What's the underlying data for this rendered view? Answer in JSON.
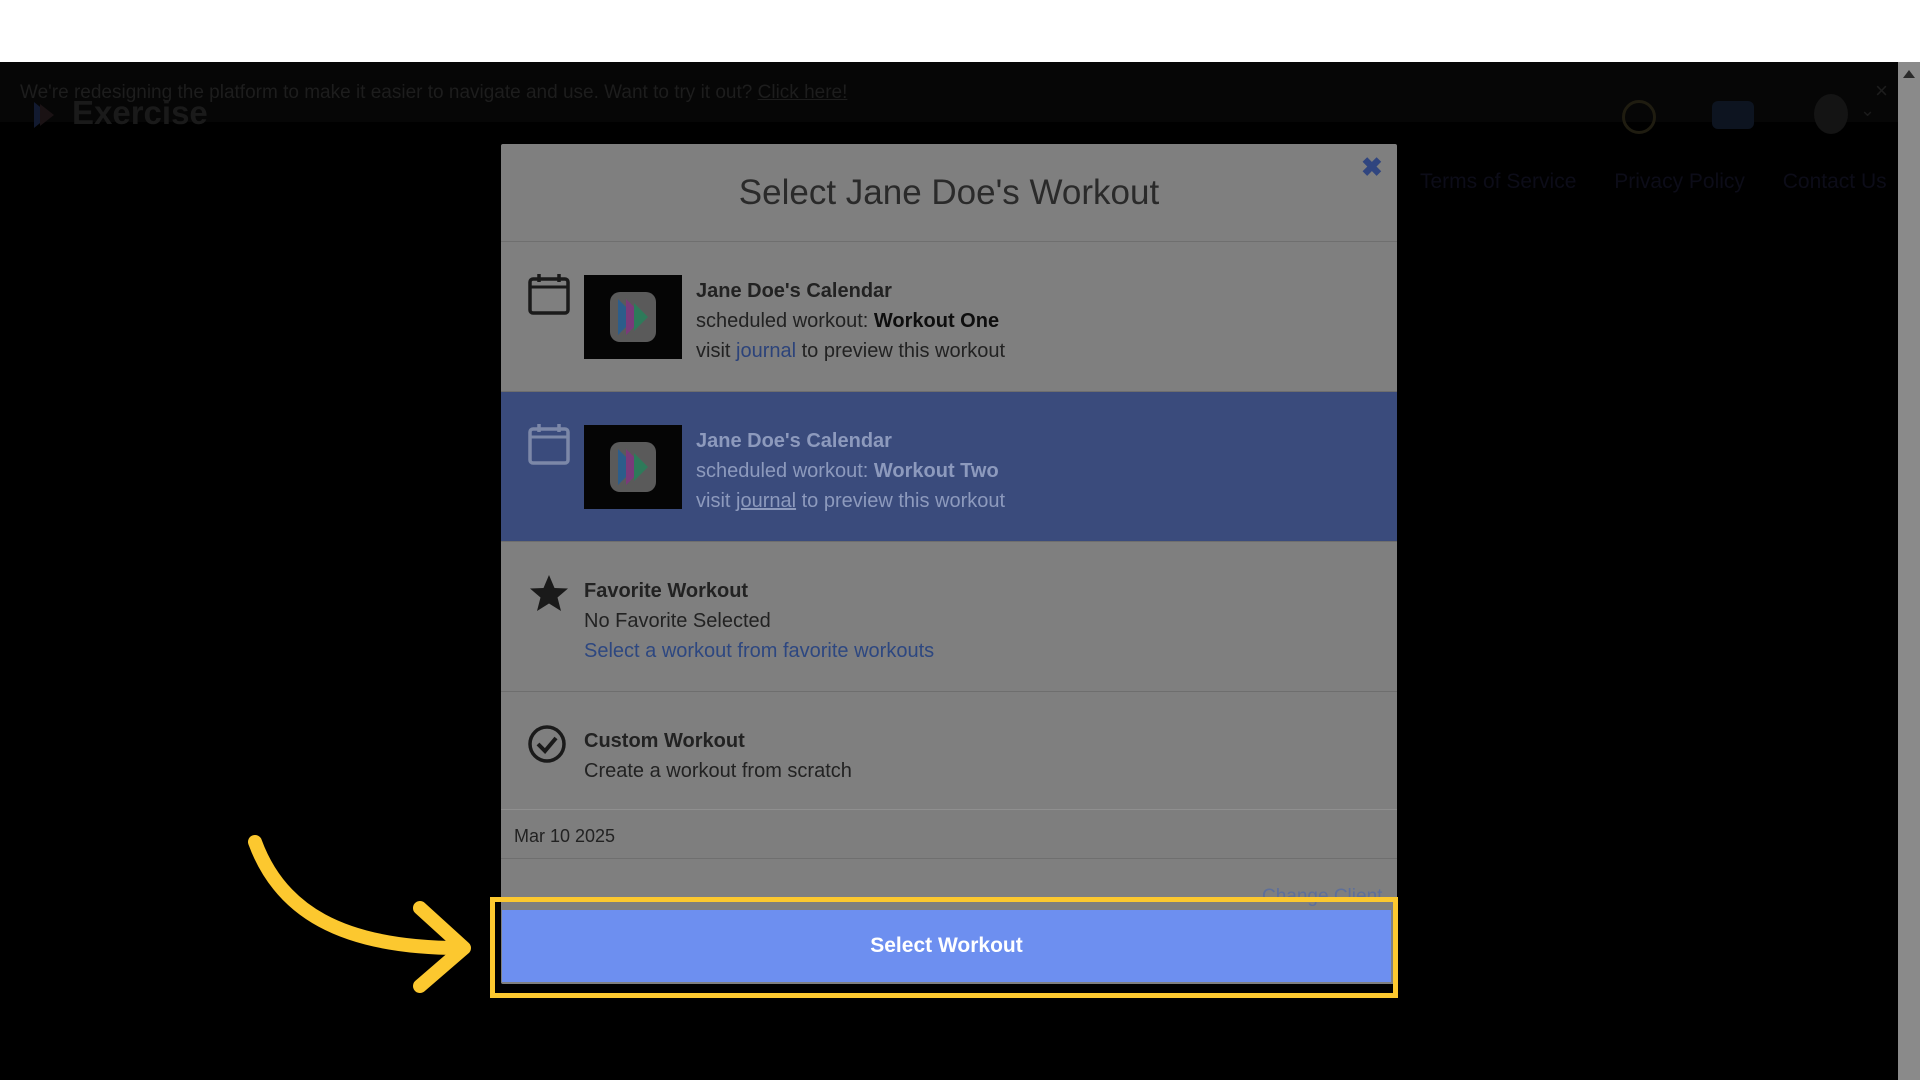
{
  "banner": {
    "message": "We're redesigning the platform to make it easier to navigate and use. Want to try it out?",
    "link_label": "Click here!",
    "close_glyph": "×"
  },
  "app": {
    "logo_text": "Exercise"
  },
  "footer_links": [
    "Terms of Service",
    "Privacy Policy",
    "Contact Us"
  ],
  "modal": {
    "title": "Select Jane Doe's Workout",
    "close_glyph": "✖",
    "options": [
      {
        "title": "Jane Doe's Calendar",
        "scheduled_prefix": "scheduled workout:",
        "workout_name": "Workout One",
        "visit_prefix": "visit",
        "journal_link": "journal",
        "visit_suffix": "to preview this workout",
        "icon": "calendar-icon",
        "selected": false
      },
      {
        "title": "Jane Doe's Calendar",
        "scheduled_prefix": "scheduled workout:",
        "workout_name": "Workout Two",
        "visit_prefix": "visit",
        "journal_link": "journal",
        "visit_suffix": "to preview this workout",
        "icon": "calendar-icon",
        "selected": true
      },
      {
        "title": "Favorite Workout",
        "subtitle": "No Favorite Selected",
        "link": "Select a workout from favorite workouts",
        "icon": "star-icon"
      },
      {
        "title": "Custom Workout",
        "subtitle": "Create a workout from scratch",
        "icon": "check-circle-icon"
      }
    ],
    "date": "Mar 10 2025",
    "change_link": "Change Client",
    "select_button": "Select Workout"
  },
  "colors": {
    "accent": "#6d8ff0",
    "highlight": "#fcc82f",
    "selected_row": "#3a4b7c"
  }
}
